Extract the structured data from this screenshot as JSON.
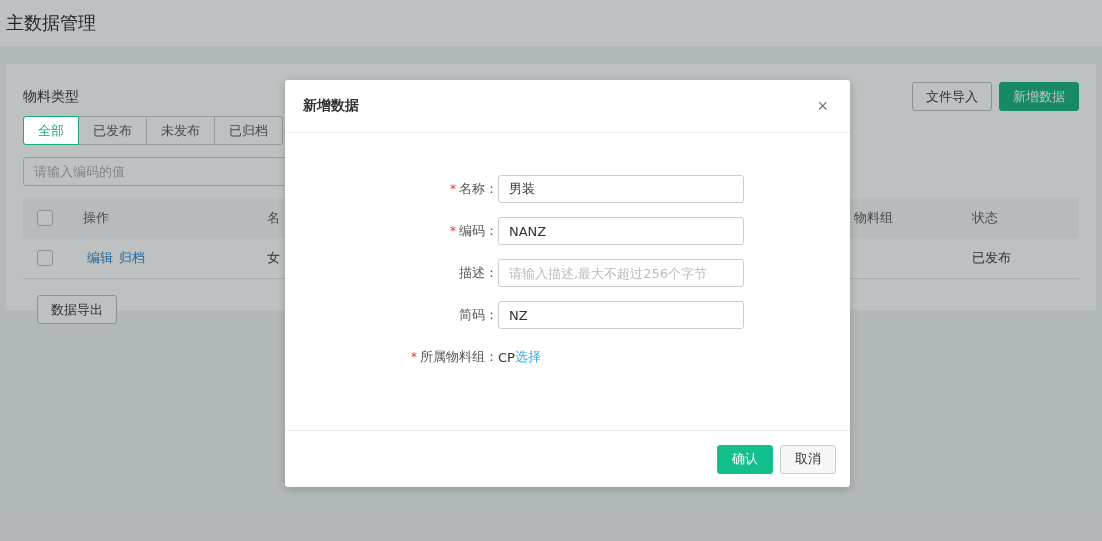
{
  "page_title": "主数据管理",
  "card": {
    "section_title": "物料类型",
    "filter_tabs": [
      {
        "label": "全部",
        "selected": true
      },
      {
        "label": "已发布",
        "selected": false
      },
      {
        "label": "未发布",
        "selected": false
      },
      {
        "label": "已归档",
        "selected": false
      }
    ],
    "search": {
      "placeholder": "请输入编码的值"
    },
    "actions": [
      "文件导入",
      "新增数据"
    ],
    "table": {
      "header_checked": false,
      "columns": [
        "操作",
        "名",
        "物料组",
        "状态"
      ],
      "rows": [
        {
          "checked": false,
          "links": [
            "编辑",
            "归档"
          ],
          "name": "女",
          "status": "已发布"
        }
      ]
    },
    "export_button": "数据导出"
  },
  "dialog": {
    "title": "新增数据",
    "close": "×",
    "fields": [
      {
        "kind": "input",
        "required_mark": "*",
        "label": "名称：",
        "value": "男装"
      },
      {
        "kind": "input",
        "required_mark": "*",
        "label": "编码：",
        "value": "NANZ"
      },
      {
        "kind": "input",
        "label": "描述：",
        "placeholder": "请输入描述,最大不超过256个字节"
      },
      {
        "kind": "input",
        "label": "简码：",
        "value": "NZ"
      },
      {
        "kind": "picker",
        "required_mark": "*",
        "label": "所属物料组：",
        "value": "CP",
        "link": "选择"
      }
    ],
    "buttons": [
      {
        "kind": "primary",
        "label": "确认"
      },
      {
        "kind": "default",
        "label": "取消"
      }
    ]
  }
}
